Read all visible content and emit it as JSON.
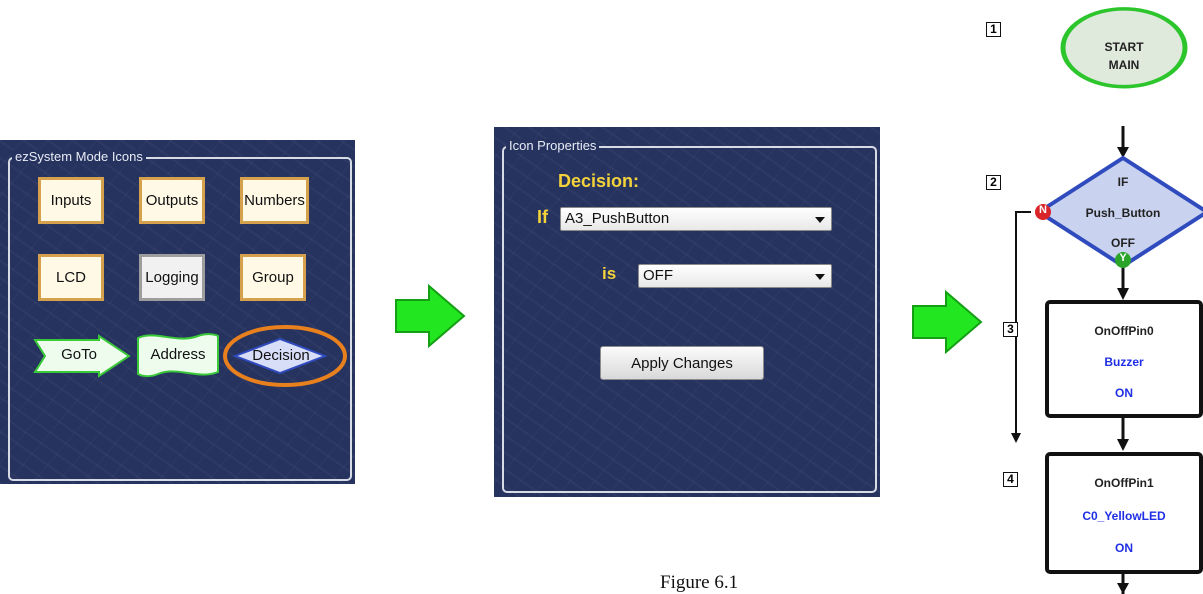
{
  "icons_panel": {
    "title": "ezSystem Mode Icons",
    "buttons": [
      "Inputs",
      "Outputs",
      "Numbers",
      "LCD",
      "Logging",
      "Group"
    ],
    "goto_label": "GoTo",
    "address_label": "Address",
    "decision_label": "Decision",
    "highlight_color": "#e8801e"
  },
  "properties_panel": {
    "title": "Icon Properties",
    "heading": "Decision:",
    "if_label": "If",
    "if_value": "A3_PushButton",
    "is_label": "is",
    "is_value": "OFF",
    "apply_label": "Apply Changes"
  },
  "flowchart": {
    "step1": {
      "number": "1",
      "line1": "START",
      "line2": "MAIN"
    },
    "step2": {
      "number": "2",
      "line1": "IF",
      "line2": "Push_Button",
      "line3": "OFF",
      "no_label": "N",
      "yes_label": "Y"
    },
    "step3": {
      "number": "3",
      "line1": "OnOffPin0",
      "line2": "Buzzer",
      "line3": "ON"
    },
    "step4": {
      "number": "4",
      "line1": "OnOffPin1",
      "line2": "C0_YellowLED",
      "line3": "ON"
    }
  },
  "caption": "Figure 6.1",
  "colors": {
    "panel_bg": "#26335f",
    "arrow_green": "#22e620",
    "accent_yellow": "#f3d23a",
    "flow_blue": "#1f2fe6",
    "start_green": "#2cc62c"
  }
}
